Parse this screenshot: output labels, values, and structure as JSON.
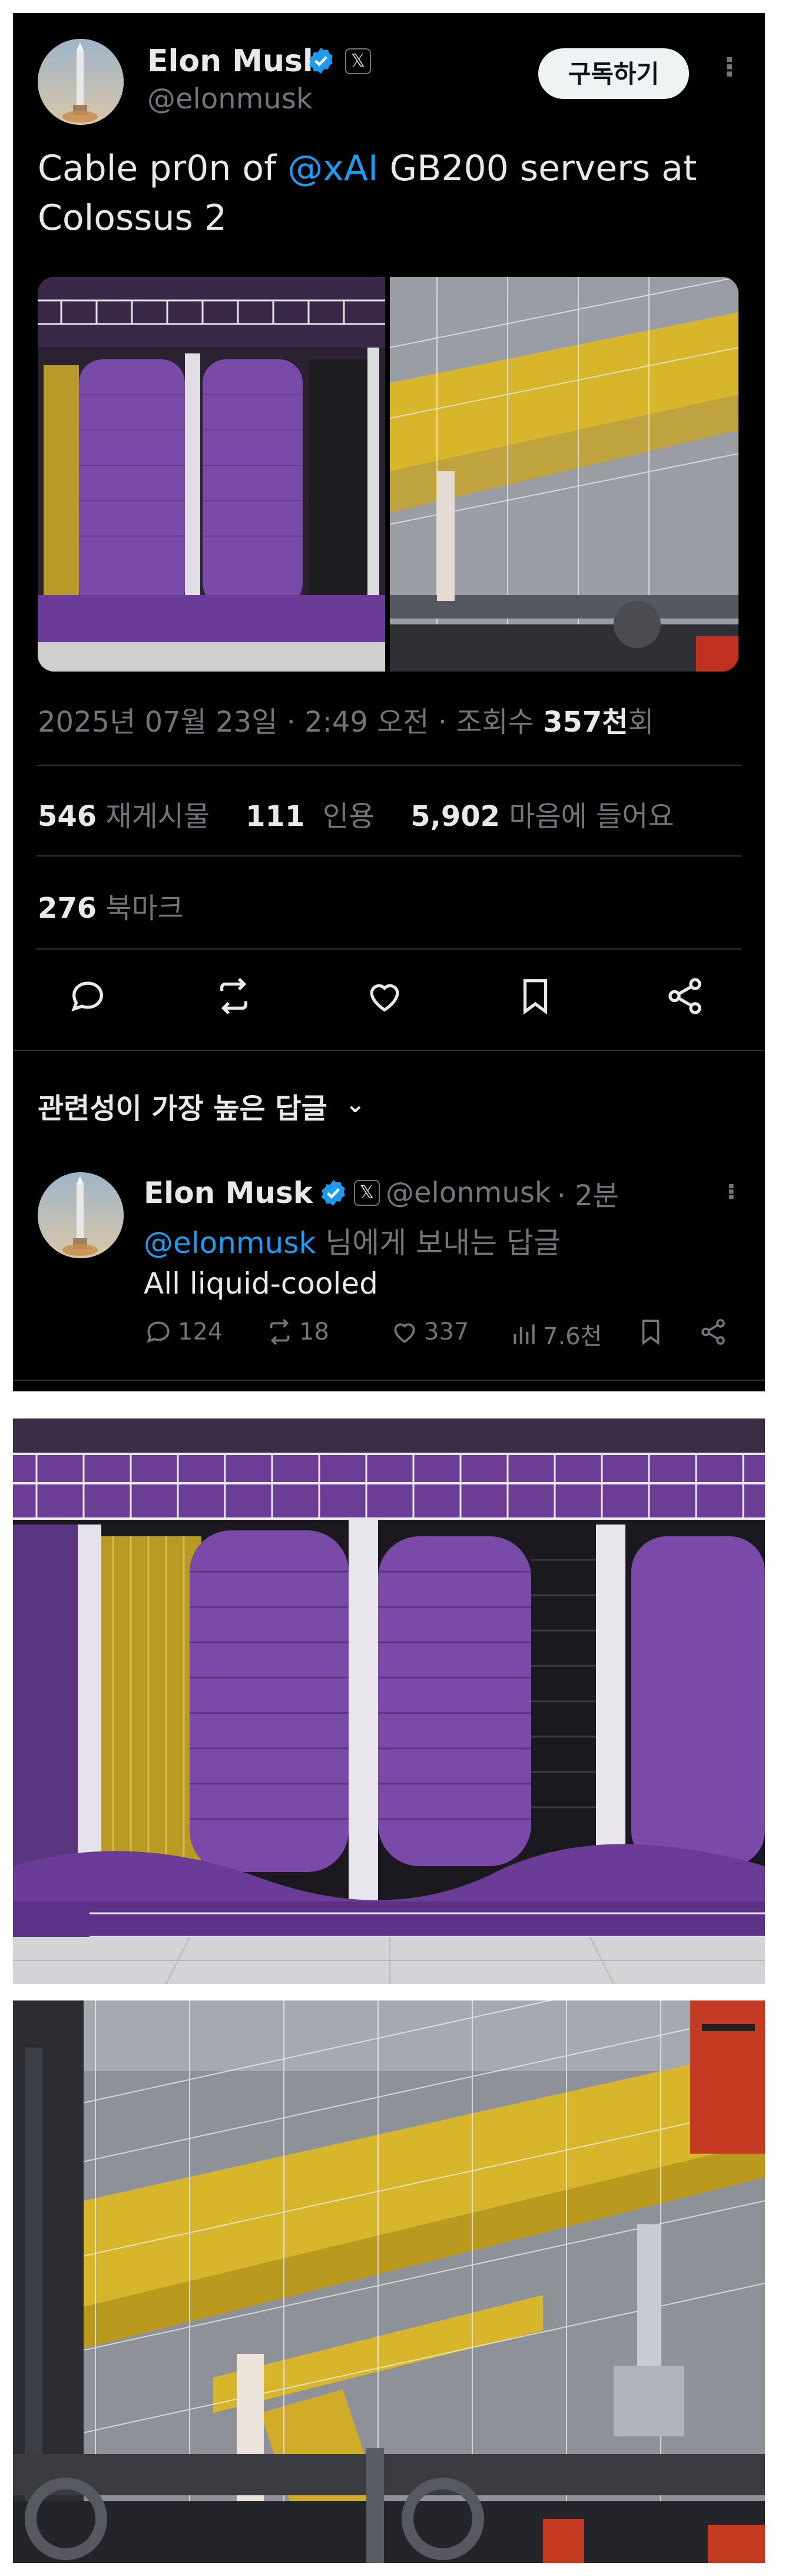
{
  "tweet": {
    "author_name": "Elon Musk",
    "author_handle": "@elonmusk",
    "follow_label": "구독하기",
    "text_before": "Cable pr0n of ",
    "text_mention": "@xAI",
    "text_after": " GB200 servers at Colossus 2",
    "date": "2025년 07월 23일",
    "time": "2:49 오전",
    "views_label": "조회수",
    "views_value": "357천",
    "views_suffix": "회",
    "sep": "·"
  },
  "stats": {
    "reposts_count": "546",
    "reposts_label": "재게시물",
    "quotes_count": "111",
    "quotes_label": "인용",
    "likes_count": "5,902",
    "likes_label": "마음에 들어요",
    "bookmarks_count": "276",
    "bookmarks_label": "북마크"
  },
  "replies_section": {
    "title": "관련성이 가장 높은 답글",
    "chevron": "⌄"
  },
  "reply": {
    "author_name": "Elon Musk",
    "author_handle": "@elonmusk",
    "time_ago": "· 2분",
    "replying_to_mention": "@elonmusk",
    "replying_to_suffix": " 님에게 보내는 답글",
    "text": "All liquid-cooled",
    "reply_count": "124",
    "repost_count": "18",
    "like_count": "337",
    "view_count": "7.6천"
  },
  "icons": {
    "verified": "verified-badge-icon",
    "x_badge": "𝕏",
    "more": "···"
  },
  "colors": {
    "background": "#000000",
    "accent": "#1d9bf0",
    "text": "#e7e9ea",
    "muted": "#71767b",
    "cable_purple": "#7a4aa8",
    "tray_yellow": "#d8b62c"
  }
}
